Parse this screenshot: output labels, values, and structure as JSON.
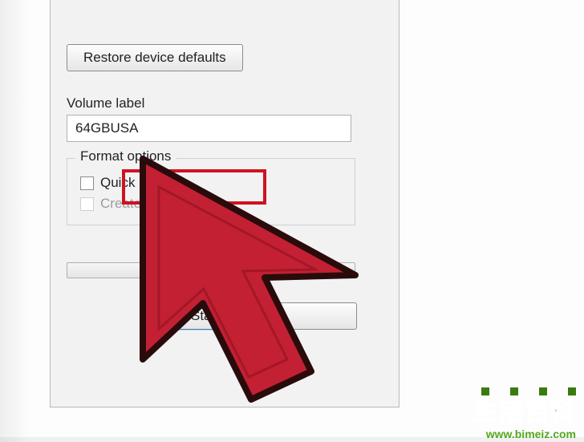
{
  "buttons": {
    "restore_defaults": "Restore device defaults",
    "start": "Start"
  },
  "labels": {
    "volume_label": "Volume label",
    "format_options": "Format options"
  },
  "fields": {
    "volume_value": "64GBUSA"
  },
  "options": {
    "quick_format": "Quick Format",
    "create_msdos": "Create an MS-D"
  },
  "watermark": {
    "title_cn": "生活百科",
    "url": "www.bimeiz.com"
  }
}
